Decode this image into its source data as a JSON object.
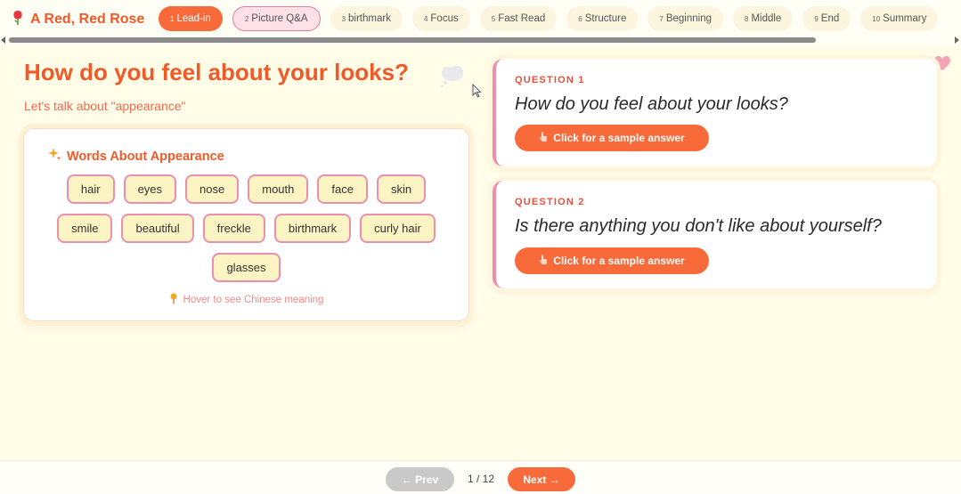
{
  "brand": {
    "title": "A Red, Red Rose",
    "icon": "rose-icon"
  },
  "tabs": [
    {
      "num": "1",
      "label": "Lead-in",
      "state": "active"
    },
    {
      "num": "2",
      "label": "Picture Q&A",
      "state": "highlight"
    },
    {
      "num": "3",
      "label": "birthmark",
      "state": "normal"
    },
    {
      "num": "4",
      "label": "Focus",
      "state": "normal"
    },
    {
      "num": "5",
      "label": "Fast Read",
      "state": "normal"
    },
    {
      "num": "6",
      "label": "Structure",
      "state": "normal"
    },
    {
      "num": "7",
      "label": "Beginning",
      "state": "normal"
    },
    {
      "num": "8",
      "label": "Middle",
      "state": "normal"
    },
    {
      "num": "9",
      "label": "End",
      "state": "normal"
    },
    {
      "num": "10",
      "label": "Summary",
      "state": "normal"
    }
  ],
  "main": {
    "title": "How do you feel about your looks?",
    "subtitle": "Let's talk about \"appearance\""
  },
  "words": {
    "title": "Words About Appearance",
    "rows": [
      [
        "hair",
        "eyes",
        "nose",
        "mouth",
        "face",
        "skin"
      ],
      [
        "smile",
        "beautiful",
        "freckle",
        "birthmark",
        "curly hair"
      ],
      [
        "glasses"
      ]
    ],
    "hint": "Hover to see Chinese meaning"
  },
  "questions": [
    {
      "label": "QUESTION 1",
      "text": "How do you feel about your looks?",
      "button": "Click for a sample answer"
    },
    {
      "label": "QUESTION 2",
      "text": "Is there anything you don't like about yourself?",
      "button": "Click for a sample answer"
    }
  ],
  "footer": {
    "prev": "← Prev",
    "counter": "1 / 12",
    "next": "Next →"
  },
  "colors": {
    "accent": "#f86a3a",
    "title": "#f05a28",
    "pink": "#ec8eb0",
    "background": "#fffce8"
  }
}
